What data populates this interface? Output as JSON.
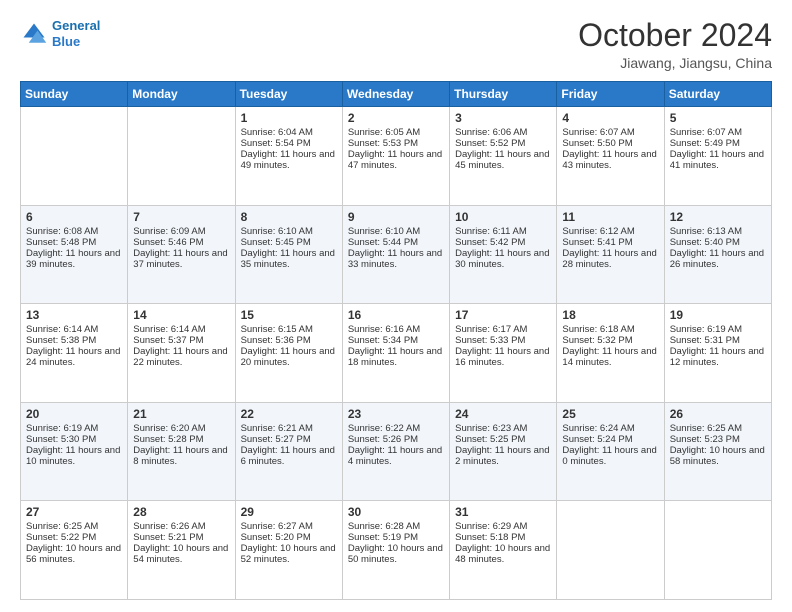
{
  "header": {
    "logo_line1": "General",
    "logo_line2": "Blue",
    "title": "October 2024",
    "subtitle": "Jiawang, Jiangsu, China"
  },
  "weekdays": [
    "Sunday",
    "Monday",
    "Tuesday",
    "Wednesday",
    "Thursday",
    "Friday",
    "Saturday"
  ],
  "weeks": [
    [
      {
        "day": "",
        "text": ""
      },
      {
        "day": "",
        "text": ""
      },
      {
        "day": "1",
        "text": "Sunrise: 6:04 AM\nSunset: 5:54 PM\nDaylight: 11 hours and 49 minutes."
      },
      {
        "day": "2",
        "text": "Sunrise: 6:05 AM\nSunset: 5:53 PM\nDaylight: 11 hours and 47 minutes."
      },
      {
        "day": "3",
        "text": "Sunrise: 6:06 AM\nSunset: 5:52 PM\nDaylight: 11 hours and 45 minutes."
      },
      {
        "day": "4",
        "text": "Sunrise: 6:07 AM\nSunset: 5:50 PM\nDaylight: 11 hours and 43 minutes."
      },
      {
        "day": "5",
        "text": "Sunrise: 6:07 AM\nSunset: 5:49 PM\nDaylight: 11 hours and 41 minutes."
      }
    ],
    [
      {
        "day": "6",
        "text": "Sunrise: 6:08 AM\nSunset: 5:48 PM\nDaylight: 11 hours and 39 minutes."
      },
      {
        "day": "7",
        "text": "Sunrise: 6:09 AM\nSunset: 5:46 PM\nDaylight: 11 hours and 37 minutes."
      },
      {
        "day": "8",
        "text": "Sunrise: 6:10 AM\nSunset: 5:45 PM\nDaylight: 11 hours and 35 minutes."
      },
      {
        "day": "9",
        "text": "Sunrise: 6:10 AM\nSunset: 5:44 PM\nDaylight: 11 hours and 33 minutes."
      },
      {
        "day": "10",
        "text": "Sunrise: 6:11 AM\nSunset: 5:42 PM\nDaylight: 11 hours and 30 minutes."
      },
      {
        "day": "11",
        "text": "Sunrise: 6:12 AM\nSunset: 5:41 PM\nDaylight: 11 hours and 28 minutes."
      },
      {
        "day": "12",
        "text": "Sunrise: 6:13 AM\nSunset: 5:40 PM\nDaylight: 11 hours and 26 minutes."
      }
    ],
    [
      {
        "day": "13",
        "text": "Sunrise: 6:14 AM\nSunset: 5:38 PM\nDaylight: 11 hours and 24 minutes."
      },
      {
        "day": "14",
        "text": "Sunrise: 6:14 AM\nSunset: 5:37 PM\nDaylight: 11 hours and 22 minutes."
      },
      {
        "day": "15",
        "text": "Sunrise: 6:15 AM\nSunset: 5:36 PM\nDaylight: 11 hours and 20 minutes."
      },
      {
        "day": "16",
        "text": "Sunrise: 6:16 AM\nSunset: 5:34 PM\nDaylight: 11 hours and 18 minutes."
      },
      {
        "day": "17",
        "text": "Sunrise: 6:17 AM\nSunset: 5:33 PM\nDaylight: 11 hours and 16 minutes."
      },
      {
        "day": "18",
        "text": "Sunrise: 6:18 AM\nSunset: 5:32 PM\nDaylight: 11 hours and 14 minutes."
      },
      {
        "day": "19",
        "text": "Sunrise: 6:19 AM\nSunset: 5:31 PM\nDaylight: 11 hours and 12 minutes."
      }
    ],
    [
      {
        "day": "20",
        "text": "Sunrise: 6:19 AM\nSunset: 5:30 PM\nDaylight: 11 hours and 10 minutes."
      },
      {
        "day": "21",
        "text": "Sunrise: 6:20 AM\nSunset: 5:28 PM\nDaylight: 11 hours and 8 minutes."
      },
      {
        "day": "22",
        "text": "Sunrise: 6:21 AM\nSunset: 5:27 PM\nDaylight: 11 hours and 6 minutes."
      },
      {
        "day": "23",
        "text": "Sunrise: 6:22 AM\nSunset: 5:26 PM\nDaylight: 11 hours and 4 minutes."
      },
      {
        "day": "24",
        "text": "Sunrise: 6:23 AM\nSunset: 5:25 PM\nDaylight: 11 hours and 2 minutes."
      },
      {
        "day": "25",
        "text": "Sunrise: 6:24 AM\nSunset: 5:24 PM\nDaylight: 11 hours and 0 minutes."
      },
      {
        "day": "26",
        "text": "Sunrise: 6:25 AM\nSunset: 5:23 PM\nDaylight: 10 hours and 58 minutes."
      }
    ],
    [
      {
        "day": "27",
        "text": "Sunrise: 6:25 AM\nSunset: 5:22 PM\nDaylight: 10 hours and 56 minutes."
      },
      {
        "day": "28",
        "text": "Sunrise: 6:26 AM\nSunset: 5:21 PM\nDaylight: 10 hours and 54 minutes."
      },
      {
        "day": "29",
        "text": "Sunrise: 6:27 AM\nSunset: 5:20 PM\nDaylight: 10 hours and 52 minutes."
      },
      {
        "day": "30",
        "text": "Sunrise: 6:28 AM\nSunset: 5:19 PM\nDaylight: 10 hours and 50 minutes."
      },
      {
        "day": "31",
        "text": "Sunrise: 6:29 AM\nSunset: 5:18 PM\nDaylight: 10 hours and 48 minutes."
      },
      {
        "day": "",
        "text": ""
      },
      {
        "day": "",
        "text": ""
      }
    ]
  ]
}
